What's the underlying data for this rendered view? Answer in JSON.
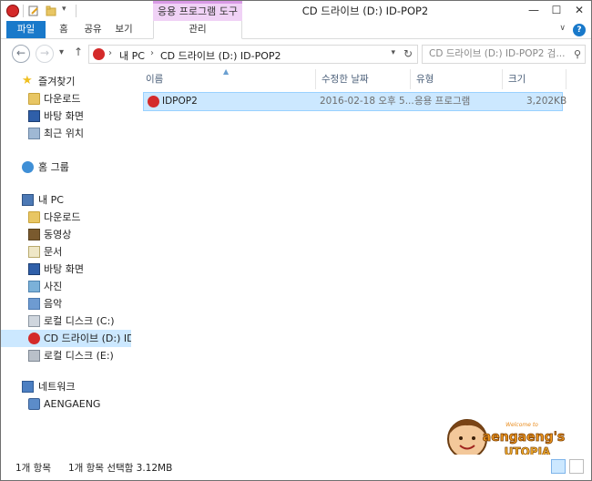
{
  "titlebar": {
    "title": "CD 드라이브 (D:) ID-POP2",
    "context_label": "응용 프로그램 도구",
    "minimize": "—",
    "maximize": "☐",
    "close": "✕"
  },
  "ribbon": {
    "tabs": [
      "파일",
      "홈",
      "공유",
      "보기",
      "관리"
    ]
  },
  "address": {
    "crumbs": [
      "내 PC",
      "CD 드라이브 (D:) ID-POP2"
    ],
    "search_placeholder": "CD 드라이브 (D:) ID-POP2 검..."
  },
  "navpane": {
    "items": [
      {
        "label": "즐겨찾기",
        "icon": "star-icon"
      },
      {
        "label": "다운로드",
        "icon": "downloads-folder-icon"
      },
      {
        "label": "바탕 화면",
        "icon": "desktop-icon"
      },
      {
        "label": "최근 위치",
        "icon": "recent-places-icon"
      },
      {
        "label": "홈 그룹",
        "icon": "homegroup-icon"
      },
      {
        "label": "내 PC",
        "icon": "this-pc-icon"
      },
      {
        "label": "다운로드",
        "icon": "downloads-folder-icon"
      },
      {
        "label": "동영상",
        "icon": "videos-folder-icon"
      },
      {
        "label": "문서",
        "icon": "documents-folder-icon"
      },
      {
        "label": "바탕 화면",
        "icon": "desktop-icon"
      },
      {
        "label": "사진",
        "icon": "pictures-folder-icon"
      },
      {
        "label": "음악",
        "icon": "music-folder-icon"
      },
      {
        "label": "로컬 디스크 (C:)",
        "icon": "system-drive-icon"
      },
      {
        "label": "CD 드라이브 (D:) ID-POP2",
        "icon": "cd-drive-icon"
      },
      {
        "label": "로컬 디스크 (E:)",
        "icon": "hard-drive-icon"
      },
      {
        "label": "네트워크",
        "icon": "network-icon"
      },
      {
        "label": "AENGAENG",
        "icon": "network-computer-icon"
      }
    ]
  },
  "columns": [
    "이름",
    "수정한 날짜",
    "유형",
    "크기"
  ],
  "files": [
    {
      "name": "IDPOP2",
      "modified": "2016-02-18 오후 5...",
      "type": "응용 프로그램",
      "size": "3,202KB"
    }
  ],
  "status": {
    "count": "1개 항목",
    "selected": "1개 항목 선택함 3.12MB"
  },
  "watermark": {
    "top": "Welcome to",
    "main": "aengaeng's",
    "sub": "UTOPIA"
  },
  "colors": {
    "accent": "#1979ca",
    "selection": "#cce8ff",
    "context_tab": "#f0d2f6",
    "app_icon": "#d42a2a"
  }
}
